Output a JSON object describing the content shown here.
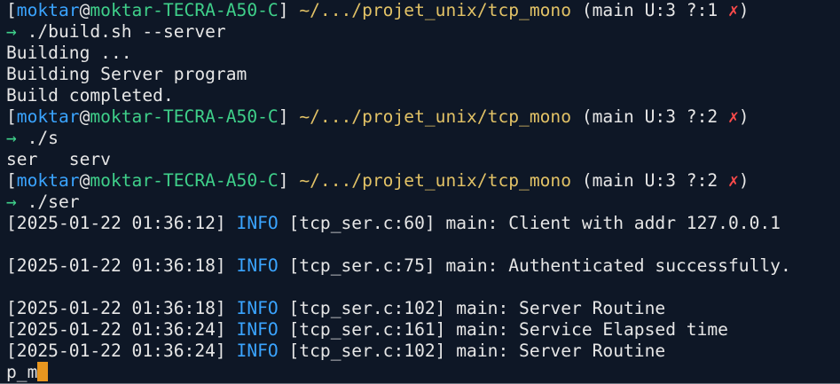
{
  "prompt": {
    "user": "moktar",
    "at": "@",
    "host": "moktar-TECRA-A50-C",
    "path": "~/.../projet_unix/tcp_mono",
    "arrow": "→",
    "fail": "✗"
  },
  "blocks": [
    {
      "git": "(main U:3 ?:1 ",
      "cmd": "./build.sh --server",
      "output": [
        "Building ...",
        "Building Server program",
        "Build completed."
      ]
    },
    {
      "git": "(main U:3 ?:2 ",
      "cmd": "./s",
      "output": [
        "ser   serv"
      ]
    },
    {
      "git": "(main U:3 ?:2 ",
      "cmd": "./ser"
    }
  ],
  "logs": [
    {
      "time": "[2025-01-22 01:36:12]",
      "level": "INFO",
      "src": "[tcp_ser.c:60]",
      "msg": "main: Client with addr 127.0.0.1",
      "blank_after": true
    },
    {
      "time": "[2025-01-22 01:36:18]",
      "level": "INFO",
      "src": "[tcp_ser.c:75]",
      "msg": "main: Authenticated successfully.",
      "blank_after": true
    },
    {
      "time": "[2025-01-22 01:36:18]",
      "level": "INFO",
      "src": "[tcp_ser.c:102]",
      "msg": "main: Server Routine",
      "blank_after": false
    },
    {
      "time": "[2025-01-22 01:36:24]",
      "level": "INFO",
      "src": "[tcp_ser.c:161]",
      "msg": "main: Service Elapsed time",
      "blank_after": false
    },
    {
      "time": "[2025-01-22 01:36:24]",
      "level": "INFO",
      "src": "[tcp_ser.c:102]",
      "msg": "main: Server Routine",
      "blank_after": false
    }
  ],
  "input_line": "p_m",
  "colors": {
    "background": "#0e1726",
    "user": "#3aa4ff",
    "host": "#3fd08a",
    "path": "#e2c266",
    "error": "#ff4b4b",
    "cursor": "#e8961f"
  }
}
